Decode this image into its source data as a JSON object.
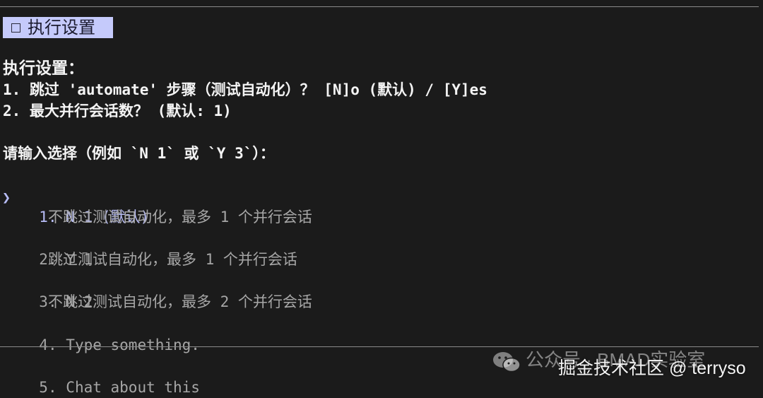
{
  "header": {
    "tab_label": "执行设置"
  },
  "settings": {
    "heading": "执行设置：",
    "items": [
      "1. 跳过 'automate' 步骤（测试自动化）？ [N]o (默认) / [Y]es",
      "2. 最大并行会话数？ (默认: 1)"
    ]
  },
  "prompt": {
    "text": "请输入选择（例如 `N 1` 或 `Y 3`）："
  },
  "options": [
    {
      "num": "1.",
      "label": "N 1 (默认)",
      "description": "不跳过测试自动化，最多 1 个并行会话",
      "selected": true
    },
    {
      "num": "2.",
      "label": "Y 1",
      "description": "跳过测试自动化，最多 1 个并行会话",
      "selected": false
    },
    {
      "num": "3.",
      "label": "N 2",
      "description": "不跳过测试自动化，最多 2 个并行会话",
      "selected": false
    },
    {
      "num": "4.",
      "label": "Type something.",
      "description": "",
      "selected": false
    },
    {
      "num": "5.",
      "label": "Chat about this",
      "description": "",
      "selected": false
    }
  ],
  "pointer_glyph": "❯",
  "watermark": {
    "line1": "公众号 · BMAD实验室",
    "line2": "掘金技术社区 @ terryso"
  },
  "colors": {
    "background": "#1b1b1b",
    "accent": "#b7bcf6",
    "badge_bg": "#c5cafb",
    "muted_text": "#a6a6a6",
    "text": "#f4f4f4"
  },
  "icons": {
    "tab": "checkbox-icon",
    "pointer": "chevron-right-icon",
    "watermark": "wechat-icon"
  }
}
